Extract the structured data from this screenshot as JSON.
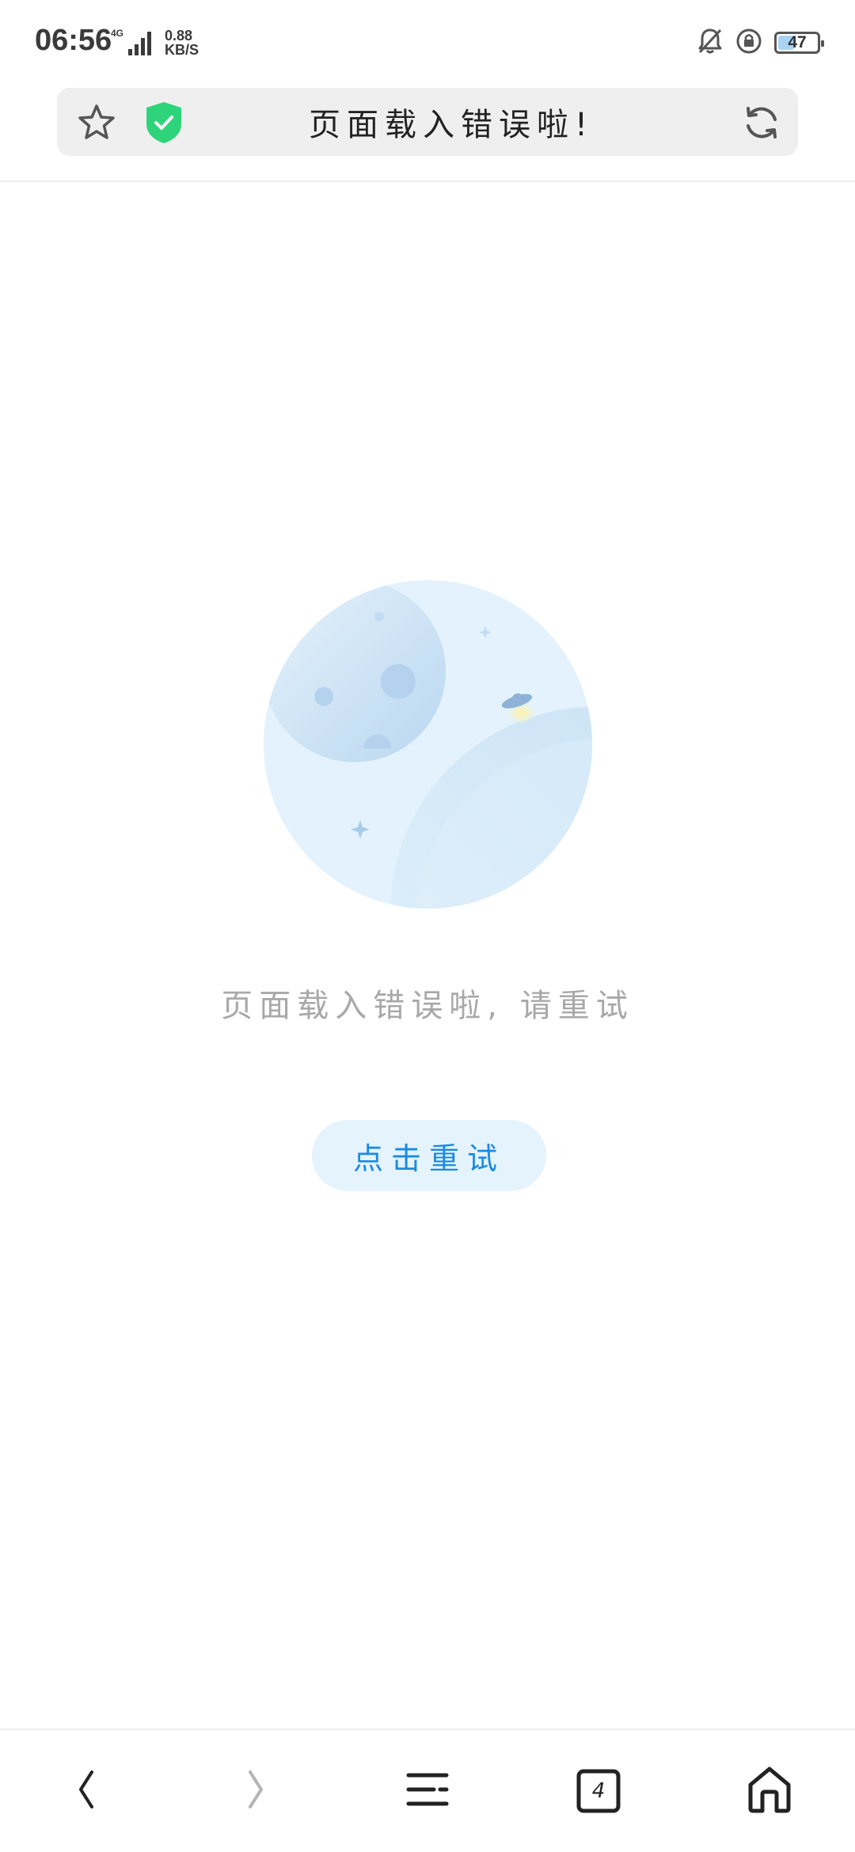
{
  "status_bar": {
    "time": "06:56",
    "network_type": "4G",
    "speed_value": "0.88",
    "speed_unit": "KB/S",
    "battery_level": "47",
    "battery_percent": 47
  },
  "url_bar": {
    "title": "页面载入错误啦!",
    "star_icon": "star-outline-icon",
    "shield_icon": "shield-check-icon",
    "refresh_icon": "refresh-icon",
    "shield_color": "#2ed47a"
  },
  "error": {
    "message": "页面载入错误啦, 请重试",
    "retry_label": "点击重试",
    "accent_color": "#1b8be0"
  },
  "bottom_nav": {
    "back_icon": "chevron-left-icon",
    "forward_icon": "chevron-right-icon",
    "menu_icon": "menu-icon",
    "tabs_icon": "tabs-icon",
    "tabs_count": "4",
    "home_icon": "home-icon"
  }
}
